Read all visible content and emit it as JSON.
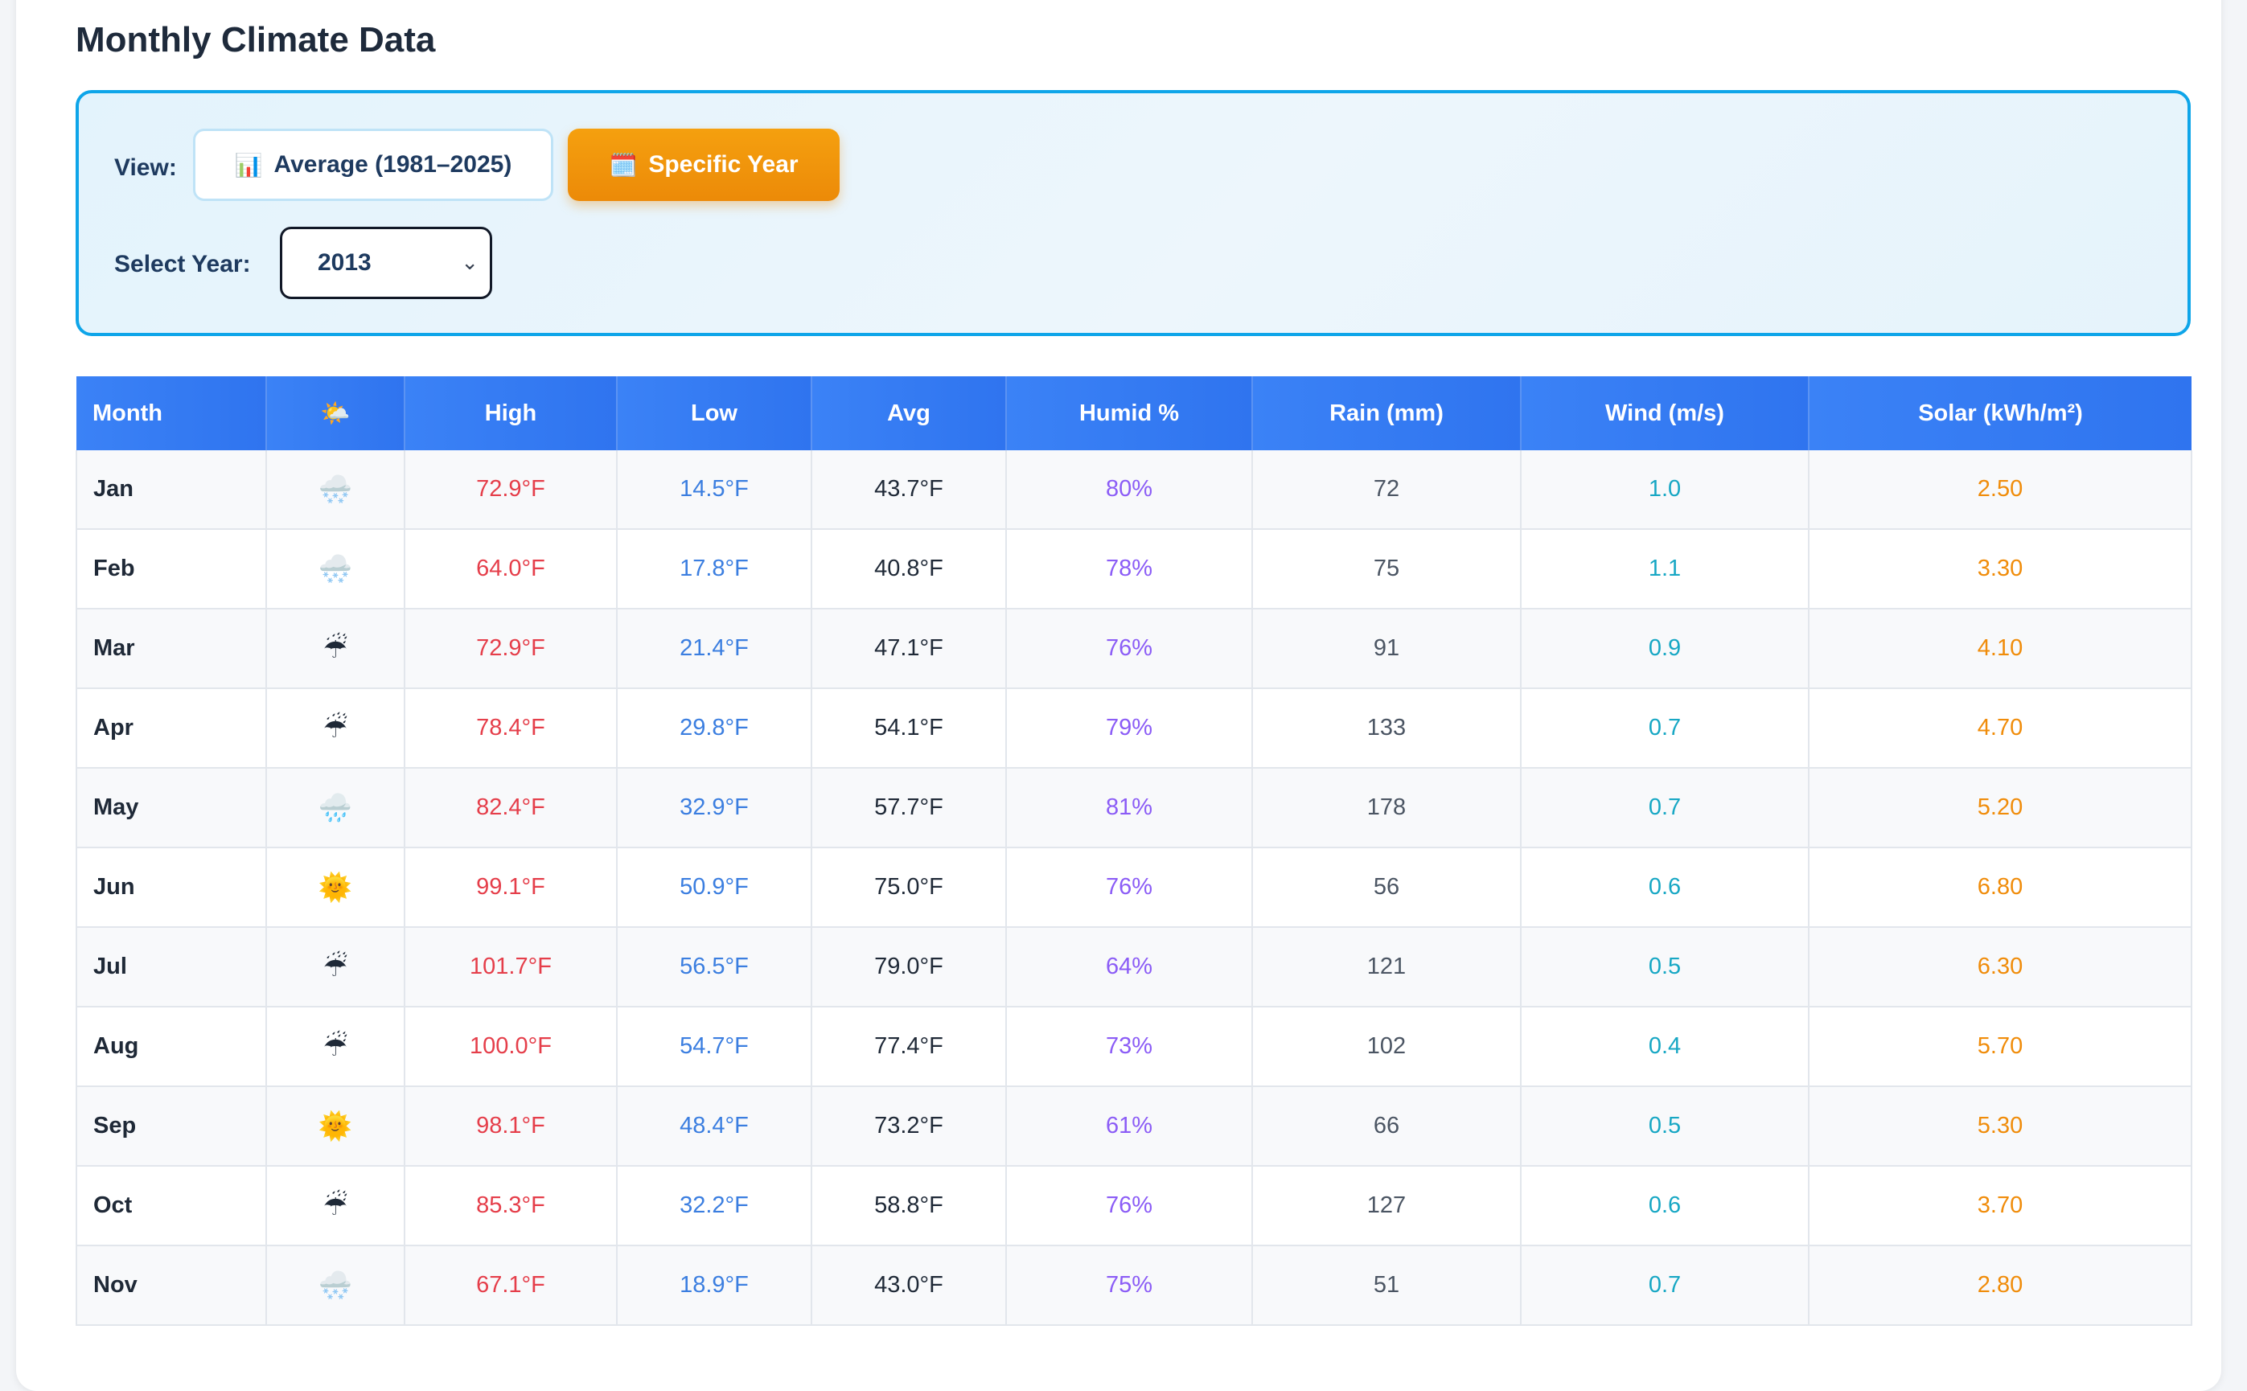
{
  "title": "Monthly Climate Data",
  "controls": {
    "view_label": "View:",
    "average_button": {
      "icon": "📊",
      "label": "Average (1981–2025)"
    },
    "specific_button": {
      "icon": "🗓️",
      "label": "Specific Year"
    },
    "year_label": "Select Year:",
    "year_value": "2013"
  },
  "table": {
    "headers": [
      "Month",
      "🌤️",
      "High",
      "Low",
      "Avg",
      "Humid %",
      "Rain (mm)",
      "Wind (m/s)",
      "Solar (kWh/m²)"
    ],
    "rows": [
      {
        "month": "Jan",
        "icon": "🌨️",
        "icon_name": "snow-cloud-icon",
        "high": "72.9°F",
        "low": "14.5°F",
        "avg": "43.7°F",
        "humid": "80%",
        "rain": "72",
        "wind": "1.0",
        "solar": "2.50"
      },
      {
        "month": "Feb",
        "icon": "🌨️",
        "icon_name": "snow-cloud-icon",
        "high": "64.0°F",
        "low": "17.8°F",
        "avg": "40.8°F",
        "humid": "78%",
        "rain": "75",
        "wind": "1.1",
        "solar": "3.30"
      },
      {
        "month": "Mar",
        "icon": "☔",
        "icon_name": "umbrella-rain-icon",
        "high": "72.9°F",
        "low": "21.4°F",
        "avg": "47.1°F",
        "humid": "76%",
        "rain": "91",
        "wind": "0.9",
        "solar": "4.10"
      },
      {
        "month": "Apr",
        "icon": "☔",
        "icon_name": "umbrella-rain-icon",
        "high": "78.4°F",
        "low": "29.8°F",
        "avg": "54.1°F",
        "humid": "79%",
        "rain": "133",
        "wind": "0.7",
        "solar": "4.70"
      },
      {
        "month": "May",
        "icon": "🌧️",
        "icon_name": "rain-cloud-icon",
        "high": "82.4°F",
        "low": "32.9°F",
        "avg": "57.7°F",
        "humid": "81%",
        "rain": "178",
        "wind": "0.7",
        "solar": "5.20"
      },
      {
        "month": "Jun",
        "icon": "🌞",
        "icon_name": "sun-icon",
        "high": "99.1°F",
        "low": "50.9°F",
        "avg": "75.0°F",
        "humid": "76%",
        "rain": "56",
        "wind": "0.6",
        "solar": "6.80"
      },
      {
        "month": "Jul",
        "icon": "☔",
        "icon_name": "umbrella-rain-icon",
        "high": "101.7°F",
        "low": "56.5°F",
        "avg": "79.0°F",
        "humid": "64%",
        "rain": "121",
        "wind": "0.5",
        "solar": "6.30"
      },
      {
        "month": "Aug",
        "icon": "☔",
        "icon_name": "umbrella-rain-icon",
        "high": "100.0°F",
        "low": "54.7°F",
        "avg": "77.4°F",
        "humid": "73%",
        "rain": "102",
        "wind": "0.4",
        "solar": "5.70"
      },
      {
        "month": "Sep",
        "icon": "🌞",
        "icon_name": "sun-icon",
        "high": "98.1°F",
        "low": "48.4°F",
        "avg": "73.2°F",
        "humid": "61%",
        "rain": "66",
        "wind": "0.5",
        "solar": "5.30"
      },
      {
        "month": "Oct",
        "icon": "☔",
        "icon_name": "umbrella-rain-icon",
        "high": "85.3°F",
        "low": "32.2°F",
        "avg": "58.8°F",
        "humid": "76%",
        "rain": "127",
        "wind": "0.6",
        "solar": "3.70"
      },
      {
        "month": "Nov",
        "icon": "🌨️",
        "icon_name": "snow-cloud-icon",
        "high": "67.1°F",
        "low": "18.9°F",
        "avg": "43.0°F",
        "humid": "75%",
        "rain": "51",
        "wind": "0.7",
        "solar": "2.80"
      }
    ]
  },
  "colors": {
    "high": "#e53e4a",
    "low": "#3b7ee0",
    "humid": "#8b5cf6",
    "wind": "#17a7c4",
    "solar": "#f08c0a",
    "header_bg": "#3b82f6",
    "active_button": "#f5a00f",
    "controls_border": "#0ea5e9"
  }
}
